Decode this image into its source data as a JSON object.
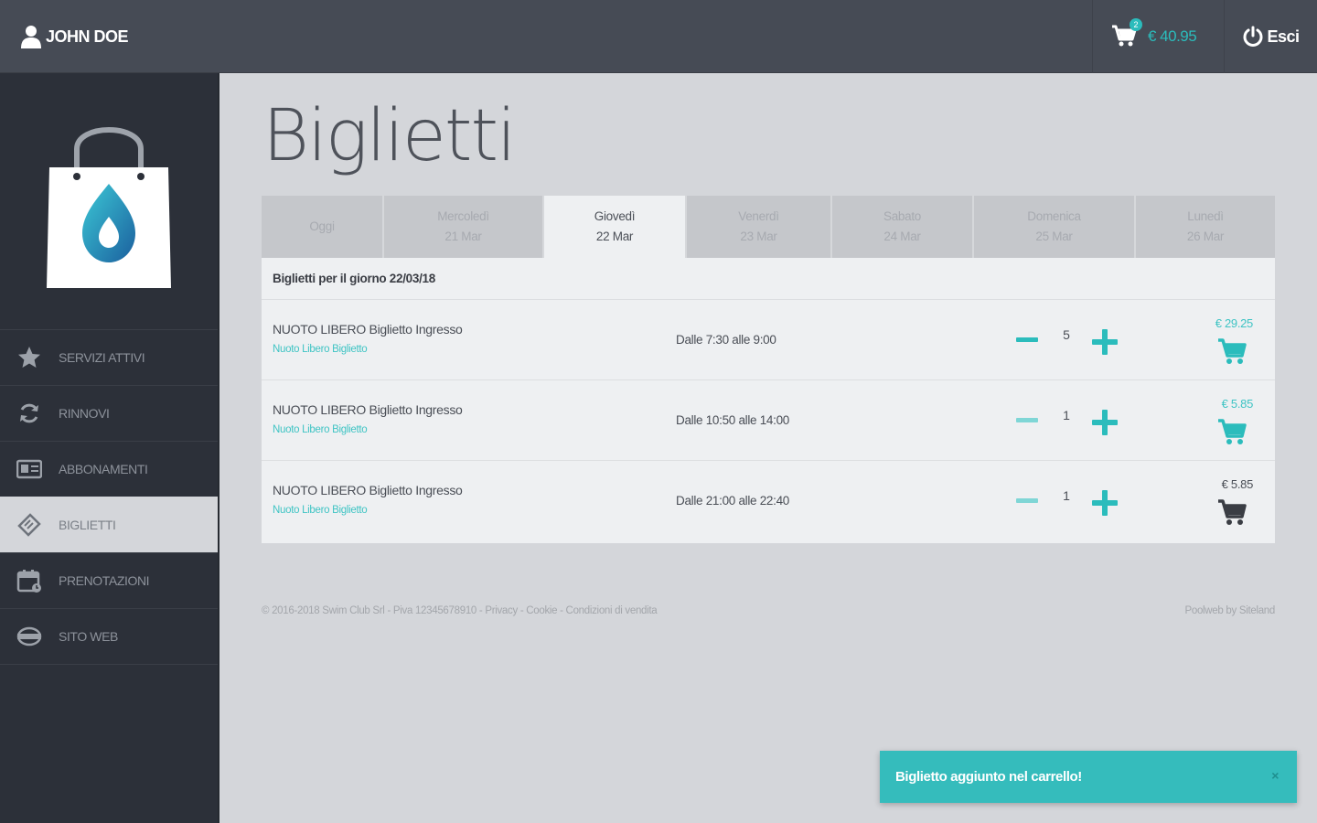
{
  "header": {
    "user_name": "JOHN DOE",
    "cart_count": "2",
    "cart_total": "€ 40.95",
    "logout_label": "Esci"
  },
  "sidebar": {
    "items": [
      {
        "label": "SERVIZI ATTIVI",
        "icon": "star-icon"
      },
      {
        "label": "RINNOVI",
        "icon": "refresh-icon"
      },
      {
        "label": "ABBONAMENTI",
        "icon": "id-card-icon"
      },
      {
        "label": "BIGLIETTI",
        "icon": "ticket-icon"
      },
      {
        "label": "PRENOTAZIONI",
        "icon": "calendar-icon"
      },
      {
        "label": "SITO WEB",
        "icon": "globe-icon"
      }
    ],
    "active_index": 3
  },
  "main": {
    "title": "Biglietti",
    "tabs": [
      {
        "day": "Oggi",
        "date": ""
      },
      {
        "day": "Mercoledì",
        "date": "21 Mar"
      },
      {
        "day": "Giovedì",
        "date": "22 Mar"
      },
      {
        "day": "Venerdì",
        "date": "23 Mar"
      },
      {
        "day": "Sabato",
        "date": "24 Mar"
      },
      {
        "day": "Domenica",
        "date": "25 Mar"
      },
      {
        "day": "Lunedì",
        "date": "26 Mar"
      }
    ],
    "active_tab": 2,
    "day_header": "Biglietti per il giorno 22/03/18",
    "tickets": [
      {
        "title": "NUOTO LIBERO Biglietto Ingresso",
        "subtitle": "Nuoto Libero Biglietto",
        "time": "Dalle 7:30 alle 9:00",
        "qty": "5",
        "price": "€ 29.25"
      },
      {
        "title": "NUOTO LIBERO Biglietto Ingresso",
        "subtitle": "Nuoto Libero Biglietto",
        "time": "Dalle 10:50 alle 14:00",
        "qty": "1",
        "price": "€ 5.85"
      },
      {
        "title": "NUOTO LIBERO Biglietto Ingresso",
        "subtitle": "Nuoto Libero Biglietto",
        "time": "Dalle 21:00 alle 22:40",
        "qty": "1",
        "price": "€ 5.85"
      }
    ]
  },
  "footer": {
    "left": "© 2016-2018 Swim Club Srl - Piva 12345678910 - Privacy - Cookie - Condizioni di vendita",
    "right": "Poolweb by Siteland"
  },
  "toast": {
    "message": "Biglietto aggiunto nel carrello!",
    "close": "×"
  },
  "colors": {
    "accent": "#2bbcbc",
    "topbar": "#464b55",
    "sidebar": "#2c3039",
    "background": "#d4d6da"
  }
}
